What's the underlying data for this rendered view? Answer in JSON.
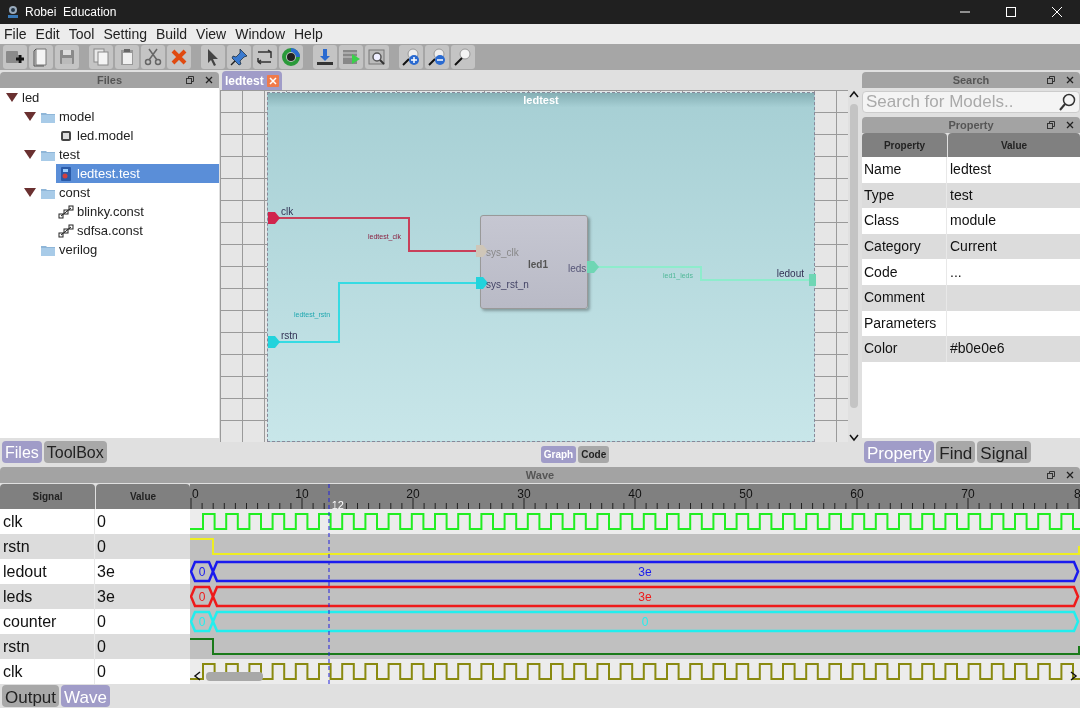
{
  "window": {
    "title": "Robei  Education"
  },
  "menu": [
    "File",
    "Edit",
    "Tool",
    "Setting",
    "Build",
    "View",
    "Window",
    "Help"
  ],
  "files_panel": {
    "title": "Files",
    "tree": [
      {
        "label": "led",
        "expanded": true,
        "selected": false,
        "children": [
          {
            "label": "model",
            "kind": "folder",
            "expanded": true,
            "selected": false,
            "children": [
              {
                "label": "led.model",
                "kind": "model",
                "selected": false
              }
            ]
          },
          {
            "label": "test",
            "kind": "folder",
            "expanded": true,
            "selected": false,
            "children": [
              {
                "label": "ledtest.test",
                "kind": "test",
                "selected": true
              }
            ]
          },
          {
            "label": "const",
            "kind": "folder",
            "expanded": true,
            "selected": false,
            "children": [
              {
                "label": "blinky.const",
                "kind": "const",
                "selected": false
              },
              {
                "label": "sdfsa.const",
                "kind": "const",
                "selected": false
              }
            ]
          },
          {
            "label": "verilog",
            "kind": "folder",
            "selected": false
          }
        ]
      }
    ]
  },
  "left_tabs": [
    {
      "label": "Files",
      "selected": true
    },
    {
      "label": "ToolBox",
      "selected": false
    }
  ],
  "editor": {
    "tabs": [
      {
        "label": "ledtest",
        "selected": true
      }
    ],
    "diagram": {
      "title": "ledtest",
      "ports": [
        {
          "label": "clk",
          "color": "#d0244c"
        },
        {
          "label": "rstn",
          "color": "#22d3dc"
        },
        {
          "label": "ledout",
          "color": "#6fd6b4"
        }
      ],
      "module": {
        "label": "led1",
        "ports": [
          {
            "label": "sys_clk",
            "color": "#cfc6b8"
          },
          {
            "label": "sys_rst_n",
            "color": "#22d3dc"
          },
          {
            "label": "leds",
            "color": "#6fd6b4"
          }
        ]
      },
      "wires": [
        {
          "label": "ledtest_clk",
          "color": "#c8405a"
        },
        {
          "label": "ledtest_rstn",
          "color": "#35dbe3"
        },
        {
          "label": "led1_leds",
          "color": "#8eeccc"
        }
      ]
    },
    "view_tabs": [
      {
        "label": "Graph",
        "selected": true
      },
      {
        "label": "Code",
        "selected": false
      }
    ]
  },
  "search_panel": {
    "title": "Search",
    "placeholder": "Search for Models.."
  },
  "property_panel": {
    "title": "Property",
    "columns": [
      "Property",
      "Value"
    ],
    "rows": [
      {
        "name": "Name",
        "value": "ledtest"
      },
      {
        "name": "Type",
        "value": "test"
      },
      {
        "name": "Class",
        "value": "module"
      },
      {
        "name": "Category",
        "value": "Current"
      },
      {
        "name": "Code",
        "value": "..."
      },
      {
        "name": "Comment"
      },
      {
        "name": "Parameters"
      },
      {
        "name": "Color",
        "value": "#b0e0e6"
      }
    ]
  },
  "right_tabs": [
    {
      "label": "Property",
      "selected": true
    },
    {
      "label": "Find",
      "selected": false
    },
    {
      "label": "Signal",
      "selected": false
    }
  ],
  "wave_panel": {
    "title": "Wave",
    "columns": [
      "Signal",
      "Value"
    ],
    "ruler": [
      "0",
      "10",
      "20",
      "30",
      "40",
      "50",
      "60",
      "70",
      "8"
    ],
    "cursor": "12",
    "signals": [
      {
        "name": "clk",
        "value": "0",
        "kind": "clock",
        "color": "#22ee22"
      },
      {
        "name": "rstn",
        "value": "0",
        "kind": "step",
        "color": "#eeee22"
      },
      {
        "name": "ledout",
        "value": "3e",
        "kind": "bus",
        "color": "#1a1aee",
        "segments": [
          "0",
          "3e"
        ]
      },
      {
        "name": "leds",
        "value": "3e",
        "kind": "bus",
        "color": "#ee1a1a",
        "segments": [
          "0",
          "3e"
        ]
      },
      {
        "name": "counter",
        "value": "0",
        "kind": "bus",
        "color": "#22eeee",
        "segments": [
          "0",
          "0"
        ]
      },
      {
        "name": "rstn",
        "value": "0",
        "kind": "step",
        "color": "#1a7a1a"
      },
      {
        "name": "clk",
        "value": "0",
        "kind": "clock",
        "color": "#8a8a10"
      }
    ]
  },
  "bottom_tabs": [
    {
      "label": "Output",
      "selected": false
    },
    {
      "label": "Wave",
      "selected": true
    }
  ]
}
